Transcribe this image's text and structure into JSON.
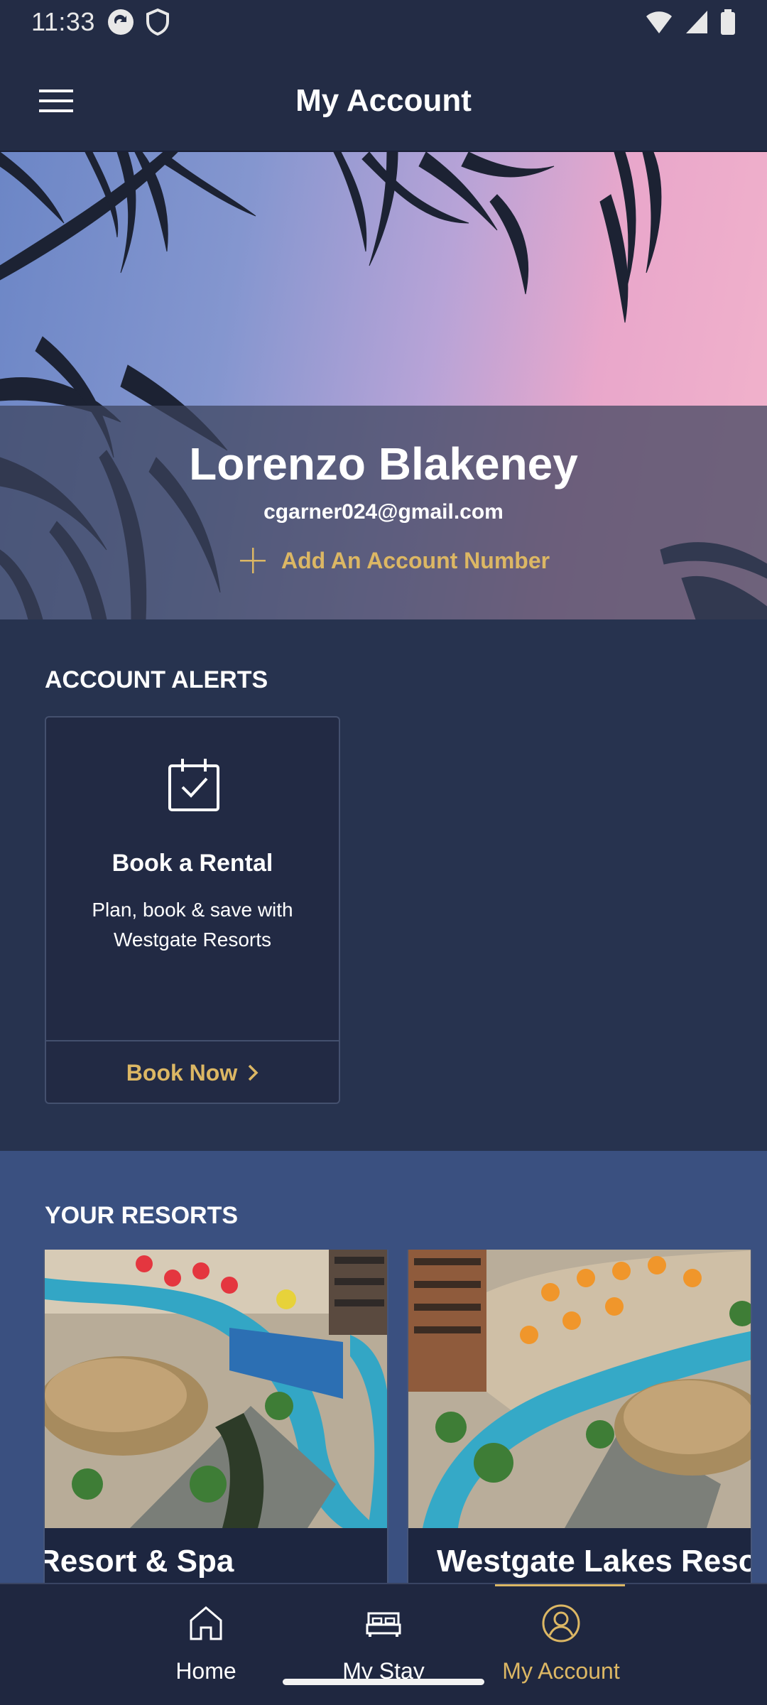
{
  "status_bar": {
    "time": "11:33"
  },
  "header": {
    "title": "My Account"
  },
  "profile": {
    "name": "Lorenzo Blakeney",
    "email": "cgarner024@gmail.com",
    "add_account_label": "Add An Account Number"
  },
  "account_alerts": {
    "title": "ACCOUNT ALERTS",
    "card": {
      "icon": "calendar-check-icon",
      "title": "Book a Rental",
      "description": "Plan, book & save with Westgate Resorts",
      "cta_label": "Book Now"
    }
  },
  "resorts": {
    "title": "YOUR RESORTS",
    "items": [
      {
        "name": "Resort & Spa"
      },
      {
        "name": "Westgate Lakes Resor"
      }
    ]
  },
  "bottom_nav": {
    "items": [
      {
        "label": "Home",
        "icon": "home-icon"
      },
      {
        "label": "My Stay",
        "icon": "bed-icon"
      },
      {
        "label": "My Account",
        "icon": "user-circle-icon"
      }
    ],
    "active": "My Account"
  },
  "colors": {
    "accent": "#dcb764",
    "header_bg": "#232c45",
    "page_bg": "#27334f",
    "resorts_bg": "#3a5080"
  }
}
